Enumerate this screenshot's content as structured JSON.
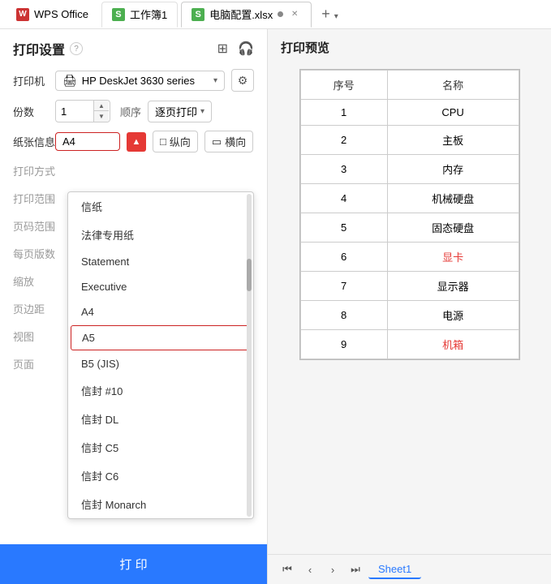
{
  "titlebar": {
    "tab1_icon": "W",
    "tab1_label": "WPS Office",
    "tab2_icon": "S",
    "tab2_label": "工作簿1",
    "tab3_icon": "S",
    "tab3_label": "电脑配置.xlsx",
    "add_tab": "+"
  },
  "left_panel": {
    "title": "打印设置",
    "help_icon": "?",
    "layout_icon": "⊞",
    "audio_icon": "🎧",
    "printer_label": "打印机",
    "printer_name": "HP DeskJet 3630 series",
    "settings_icon": "⚙",
    "copies_label": "份数",
    "copies_value": "1",
    "order_label": "顺序",
    "order_value": "逐页打印",
    "paper_label": "纸张信息",
    "paper_value": "A4",
    "portrait_label": "纵向",
    "landscape_label": "横向",
    "print_type_label": "打印方式",
    "print_range_label": "打印范围",
    "page_range_label": "页码范围",
    "per_page_label": "每页版数",
    "scale_label": "缩放",
    "margin_label": "页边距",
    "view_label": "视图",
    "page_label": "页面",
    "print_btn_label": "打 印"
  },
  "dropdown": {
    "items": [
      {
        "label": "信纸",
        "selected": false
      },
      {
        "label": "法律专用纸",
        "selected": false
      },
      {
        "label": "Statement",
        "selected": false
      },
      {
        "label": "Executive",
        "selected": false
      },
      {
        "label": "A4",
        "selected": false
      },
      {
        "label": "A5",
        "selected": true
      },
      {
        "label": "B5 (JIS)",
        "selected": false
      },
      {
        "label": "信封 #10",
        "selected": false
      },
      {
        "label": "信封 DL",
        "selected": false
      },
      {
        "label": "信封 C5",
        "selected": false
      },
      {
        "label": "信封 C6",
        "selected": false
      },
      {
        "label": "信封 Monarch",
        "selected": false
      }
    ]
  },
  "right_panel": {
    "title": "打印预览",
    "table": {
      "headers": [
        "序号",
        "名称"
      ],
      "rows": [
        {
          "seq": "1",
          "name": "CPU",
          "red": false
        },
        {
          "seq": "2",
          "name": "主板",
          "red": false
        },
        {
          "seq": "3",
          "name": "内存",
          "red": false
        },
        {
          "seq": "4",
          "name": "机械硬盘",
          "red": false
        },
        {
          "seq": "5",
          "name": "固态硬盘",
          "red": false
        },
        {
          "seq": "6",
          "name": "显卡",
          "red": true
        },
        {
          "seq": "7",
          "name": "显示器",
          "red": false
        },
        {
          "seq": "8",
          "name": "电源",
          "red": false
        },
        {
          "seq": "9",
          "name": "机箱",
          "red": true
        }
      ]
    },
    "sheet_tab": "Sheet1"
  }
}
